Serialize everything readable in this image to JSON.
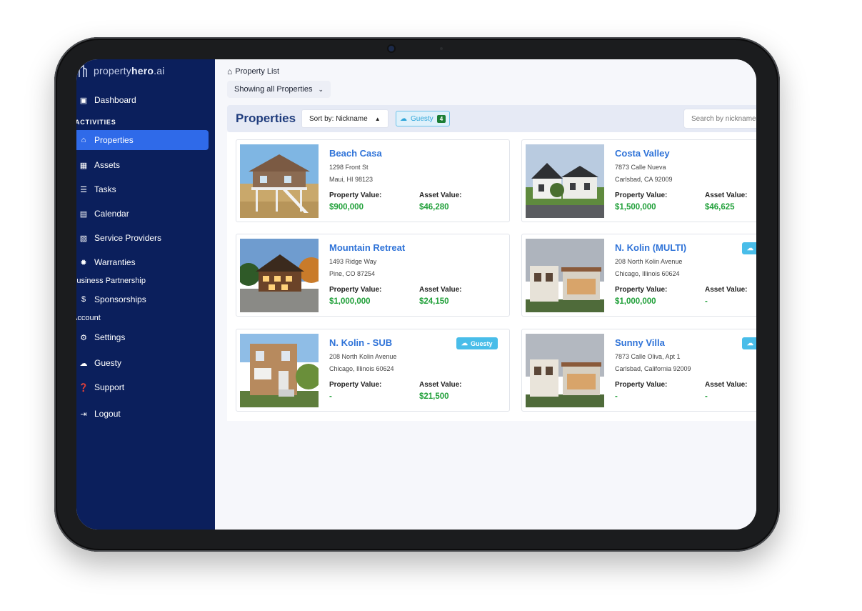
{
  "app": {
    "logo_primary": "property",
    "logo_brand": "hero",
    "logo_suffix": ".ai"
  },
  "sidebar": {
    "items": [
      {
        "label": "Dashboard",
        "icon": "dashboard-icon"
      },
      {
        "section": "ACTIVITIES"
      },
      {
        "label": "Properties",
        "icon": "home-icon",
        "active": true
      },
      {
        "label": "Assets",
        "icon": "assets-icon"
      },
      {
        "label": "Tasks",
        "icon": "tasks-icon"
      },
      {
        "label": "Calendar",
        "icon": "calendar-icon"
      },
      {
        "label": "Service Providers",
        "icon": "service-providers-icon"
      },
      {
        "label": "Warranties",
        "icon": "warranty-icon"
      },
      {
        "section": "Business Partnership"
      },
      {
        "label": "Sponsorships",
        "icon": "dollar-icon"
      },
      {
        "section": "Account"
      },
      {
        "label": "Settings",
        "icon": "gear-icon"
      },
      {
        "label": "Guesty",
        "icon": "cloud-icon"
      },
      {
        "label": "Support",
        "icon": "help-icon"
      },
      {
        "label": "Logout",
        "icon": "logout-icon"
      }
    ]
  },
  "breadcrumb": {
    "label": "Property List"
  },
  "filter": {
    "label": "Showing all Properties"
  },
  "header": {
    "title": "Properties",
    "sort_label": "Sort by: Nickname",
    "guesty_label": "Guesty",
    "guesty_count": "4",
    "search_placeholder": "Search by nickname"
  },
  "labels": {
    "property_value": "Property Value:",
    "asset_value": "Asset Value:",
    "guesty_badge": "Guesty"
  },
  "properties": [
    {
      "name": "Beach Casa",
      "address1": "1298 Front St",
      "address2": "Maui, HI 98123",
      "property_value": "$900,000",
      "asset_value": "$46,280",
      "guesty": false
    },
    {
      "name": "Costa Valley",
      "address1": "7873 Calle Nueva",
      "address2": "Carlsbad, CA 92009",
      "property_value": "$1,500,000",
      "asset_value": "$46,625",
      "guesty": false
    },
    {
      "name": "Mountain Retreat",
      "address1": "1493 Ridge Way",
      "address2": "Pine, CO 87254",
      "property_value": "$1,000,000",
      "asset_value": "$24,150",
      "guesty": false
    },
    {
      "name": "N. Kolin (MULTI)",
      "address1": "208 North Kolin Avenue",
      "address2": "Chicago, Illinois 60624",
      "property_value": "$1,000,000",
      "asset_value": "-",
      "guesty": true
    },
    {
      "name": "N. Kolin - SUB",
      "address1": "208 North Kolin Avenue",
      "address2": "Chicago, Illinois 60624",
      "property_value": "-",
      "asset_value": "$21,500",
      "guesty": true
    },
    {
      "name": "Sunny Villa",
      "address1": "7873 Calle Oliva, Apt 1",
      "address2": "Carlsbad, California 92009",
      "property_value": "-",
      "asset_value": "-",
      "guesty": true
    }
  ]
}
